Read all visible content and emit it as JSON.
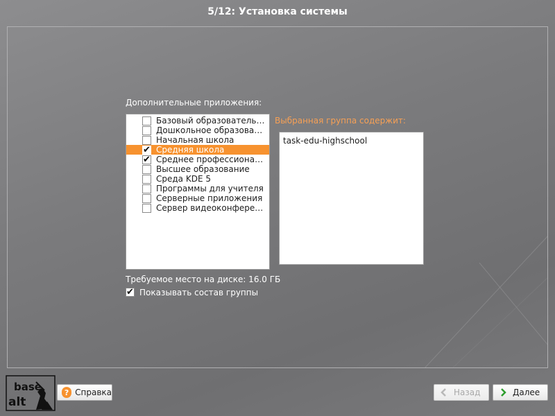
{
  "header": {
    "title": "5/12: Установка системы"
  },
  "apps": {
    "label": "Дополнительные приложения:",
    "items": [
      {
        "label": "Базовый образовательн…",
        "checked": false,
        "selected": false
      },
      {
        "label": "Дошкольное образование",
        "checked": false,
        "selected": false
      },
      {
        "label": "Начальная школа",
        "checked": false,
        "selected": false
      },
      {
        "label": "Средняя школа",
        "checked": true,
        "selected": true
      },
      {
        "label": "Среднее профессиональ…",
        "checked": true,
        "selected": false
      },
      {
        "label": "Высшее образование",
        "checked": false,
        "selected": false
      },
      {
        "label": "Среда KDE 5",
        "checked": false,
        "selected": false
      },
      {
        "label": "Программы для учителя",
        "checked": false,
        "selected": false
      },
      {
        "label": "Серверные приложения",
        "checked": false,
        "selected": false
      },
      {
        "label": "Сервер видеоконференц…",
        "checked": false,
        "selected": false
      }
    ],
    "check_mark": "✔"
  },
  "group": {
    "label": "Выбранная группа содержит:",
    "contents": [
      "task-edu-highschool"
    ]
  },
  "disk": {
    "text": "Требуемое место на диске: 16.0 ГБ"
  },
  "show_group": {
    "label": "Показывать состав группы",
    "checked": true,
    "mark": "✔"
  },
  "footer": {
    "help_label": "Справка",
    "back_label": "Назад",
    "next_label": "Далее",
    "help_icon": "?",
    "logo_top": "base",
    "logo_bottom": "alt"
  },
  "colors": {
    "accent": "#f7922f",
    "next_arrow": "#2e9e2e",
    "help_icon_bg": "#f7922f"
  }
}
